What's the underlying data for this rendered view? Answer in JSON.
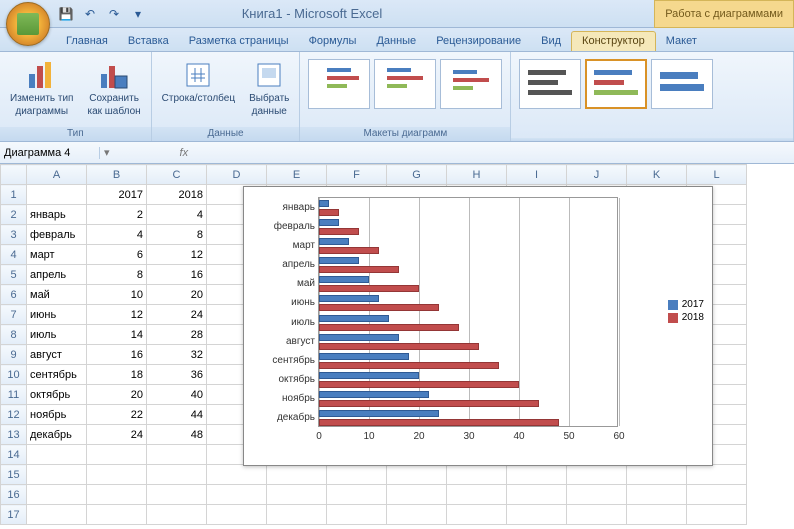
{
  "title": "Книга1 - Microsoft Excel",
  "context_tab": "Работа с диаграммами",
  "tabs": [
    "Главная",
    "Вставка",
    "Разметка страницы",
    "Формулы",
    "Данные",
    "Рецензирование",
    "Вид",
    "Конструктор",
    "Макет"
  ],
  "active_tab_index": 7,
  "ribbon": {
    "group_type": "Тип",
    "btn_change_type_l1": "Изменить тип",
    "btn_change_type_l2": "диаграммы",
    "btn_save_tpl_l1": "Сохранить",
    "btn_save_tpl_l2": "как шаблон",
    "group_data": "Данные",
    "btn_rowcol": "Строка/столбец",
    "btn_select_l1": "Выбрать",
    "btn_select_l2": "данные",
    "group_layouts": "Макеты диаграмм"
  },
  "namebox": "Диаграмма 4",
  "fx": "",
  "col_headers": [
    "A",
    "B",
    "C",
    "D",
    "E",
    "F",
    "G",
    "H",
    "I",
    "J",
    "K",
    "L"
  ],
  "rows": [
    {
      "n": "1",
      "a": "",
      "b": "2017",
      "c": "2018"
    },
    {
      "n": "2",
      "a": "январь",
      "b": "2",
      "c": "4"
    },
    {
      "n": "3",
      "a": "февраль",
      "b": "4",
      "c": "8"
    },
    {
      "n": "4",
      "a": "март",
      "b": "6",
      "c": "12"
    },
    {
      "n": "5",
      "a": "апрель",
      "b": "8",
      "c": "16"
    },
    {
      "n": "6",
      "a": "май",
      "b": "10",
      "c": "20"
    },
    {
      "n": "7",
      "a": "июнь",
      "b": "12",
      "c": "24"
    },
    {
      "n": "8",
      "a": "июль",
      "b": "14",
      "c": "28"
    },
    {
      "n": "9",
      "a": "август",
      "b": "16",
      "c": "32"
    },
    {
      "n": "10",
      "a": "сентябрь",
      "b": "18",
      "c": "36"
    },
    {
      "n": "11",
      "a": "октябрь",
      "b": "20",
      "c": "40"
    },
    {
      "n": "12",
      "a": "ноябрь",
      "b": "22",
      "c": "44"
    },
    {
      "n": "13",
      "a": "декабрь",
      "b": "24",
      "c": "48"
    },
    {
      "n": "14",
      "a": "",
      "b": "",
      "c": ""
    },
    {
      "n": "15",
      "a": "",
      "b": "",
      "c": ""
    },
    {
      "n": "16",
      "a": "",
      "b": "",
      "c": ""
    },
    {
      "n": "17",
      "a": "",
      "b": "",
      "c": ""
    }
  ],
  "chart_data": {
    "type": "bar",
    "categories": [
      "январь",
      "февраль",
      "март",
      "апрель",
      "май",
      "июнь",
      "июль",
      "август",
      "сентябрь",
      "октябрь",
      "ноябрь",
      "декабрь"
    ],
    "series": [
      {
        "name": "2017",
        "values": [
          2,
          4,
          6,
          8,
          10,
          12,
          14,
          16,
          18,
          20,
          22,
          24
        ],
        "color": "#4a7ebf"
      },
      {
        "name": "2018",
        "values": [
          4,
          8,
          12,
          16,
          20,
          24,
          28,
          32,
          36,
          40,
          44,
          48
        ],
        "color": "#c14d4d"
      }
    ],
    "xlim": [
      0,
      60
    ],
    "x_ticks": [
      0,
      10,
      20,
      30,
      40,
      50,
      60
    ],
    "title": "",
    "xlabel": "",
    "ylabel": ""
  }
}
